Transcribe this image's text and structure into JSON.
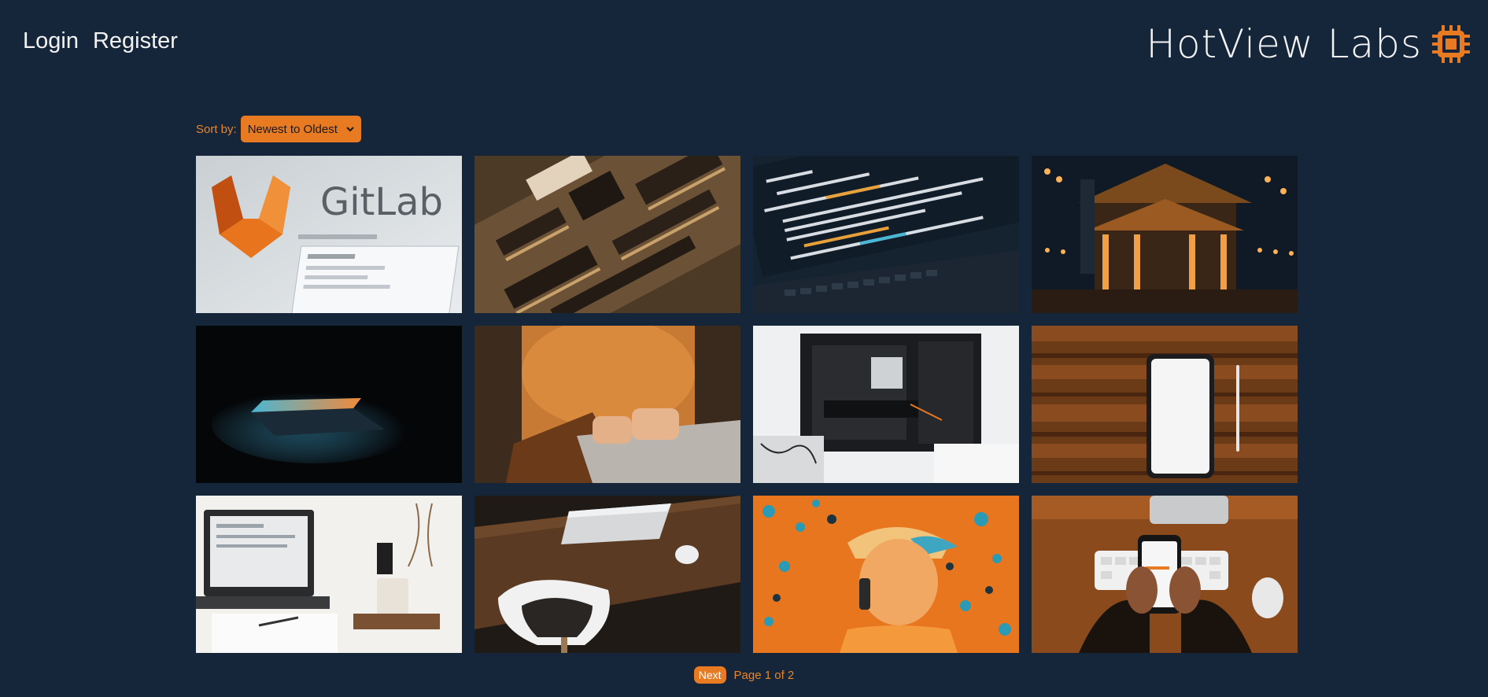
{
  "nav": {
    "login": "Login",
    "register": "Register"
  },
  "brand": {
    "name": "HotView Labs",
    "icon": "chip-icon"
  },
  "sort": {
    "label": "Sort by:",
    "selected": "Newest to Oldest"
  },
  "gallery": [
    {
      "label": "GitLab"
    },
    {
      "label": ""
    },
    {
      "label": ""
    },
    {
      "label": ""
    },
    {
      "label": ""
    },
    {
      "label": ""
    },
    {
      "label": ""
    },
    {
      "label": ""
    },
    {
      "label": ""
    },
    {
      "label": ""
    },
    {
      "label": ""
    },
    {
      "label": ""
    }
  ],
  "pagination": {
    "next": "Next",
    "info": "Page 1 of 2"
  },
  "colors": {
    "background": "#16263a",
    "accent": "#e87a22",
    "text": "#f2f2f2"
  }
}
